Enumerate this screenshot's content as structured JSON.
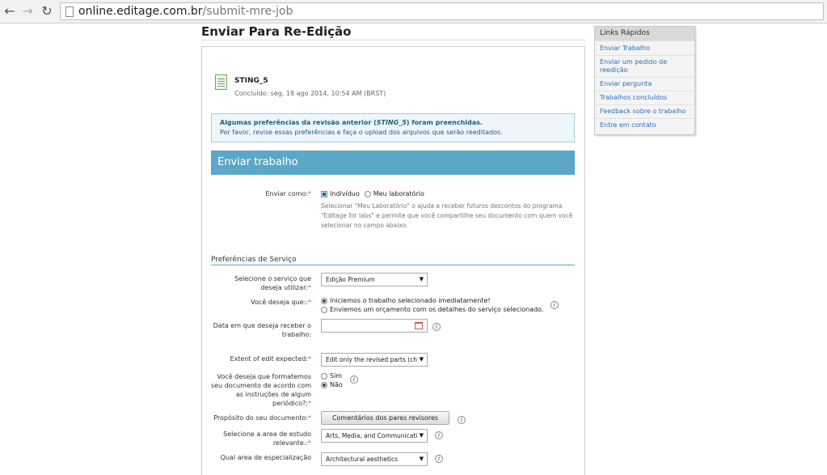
{
  "browser": {
    "url_host": "online.editage.com.br",
    "url_path": "/submit-mre-job"
  },
  "page": {
    "title": "Enviar Para Re-Edição"
  },
  "document": {
    "name": "STING_5",
    "status": "Concluído: seg, 18 ago 2014, 10:54 AM (BRST)"
  },
  "info_box": {
    "line1_prefix": "Algumas preferências da revisão anterior (",
    "line1_name": "STING_5",
    "line1_suffix": ") foram preenchidas.",
    "line2": "Por favor, revise essas preferências e faça o upload dos arquivos que serão reeditados."
  },
  "section": {
    "header": "Enviar trabalho"
  },
  "send_as": {
    "label": "Enviar como:",
    "opt_individual": "Indivíduo",
    "opt_lab": "Meu laboratório",
    "help": "Selecionar \"Meu Laboratório\" o ajuda a receber futuros descontos do programa \"Editage for labs\" e permite que você compartilhe seu documento com quem você selecionar no campo abaixo."
  },
  "preferences": {
    "title": "Preferências de Serviço",
    "service": {
      "label": "Selecione o serviço que deseja utilizar:",
      "value": "Edição Premium"
    },
    "want": {
      "label": "Você deseja que::",
      "opt1": "Iniciemos o trabalho selecionado imediatamente!",
      "opt2": "Enviemos um orçamento com os detalhes do serviço selecionado."
    },
    "date": {
      "label": "Data em que deseja receber o trabalho:"
    },
    "extent": {
      "label": "Extent of edit expected:",
      "value": "Edit only the revised parts (ch"
    },
    "format": {
      "label": "Você deseja que formatemos seu documento de acordo com as instruções de algum periódico?:",
      "yes": "Sim",
      "no": "Não"
    },
    "purpose": {
      "label": "Propósito do seu documento:",
      "button": "Comentários dos pares revisores"
    },
    "area": {
      "label": "Selecione a area de estudo relevante.:",
      "value": "Arts, Media, and Communicati"
    },
    "specialization": {
      "label": "Qual area de especialização",
      "value": "Architectural aesthetics"
    }
  },
  "quick_links": {
    "title": "Links Rápidos",
    "items": [
      "Enviar Trabalho",
      "Enviar um pedido de reedição",
      "Enviar pergunta",
      "Trabalhos concluídos",
      "Feedback sobre o trabalho",
      "Entre em contato"
    ]
  }
}
